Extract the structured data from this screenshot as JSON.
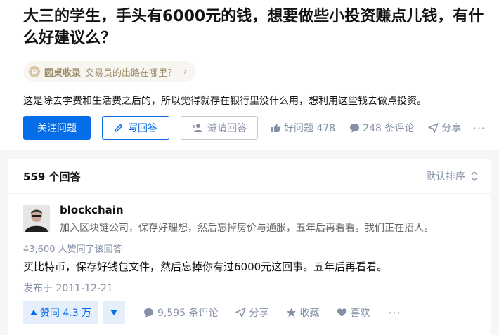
{
  "question": {
    "title": "大三的学生，手头有6000元的钱，想要做些小投资赚点儿钱，有什么好建议么？",
    "roundtable": {
      "name": "圆桌收录",
      "topic": "交易员的出路在哪里？",
      "icon": "roundtable-icon"
    },
    "detail": "这是除去学费和生活费之后的，所以觉得就存在银行里没什么用，想利用这些钱去做点投资。",
    "actions": {
      "follow_label": "关注问题",
      "write_label": "写回答",
      "invite_label": "邀请回答",
      "good_question_label": "好问题 478",
      "comments_label": "248 条评论",
      "share_label": "分享",
      "more_label": "···"
    }
  },
  "answers": {
    "count_label": "559 个回答",
    "sort_label": "默认排序",
    "items": [
      {
        "author_name": "blockchain",
        "author_bio": "加入区块链公司，保存好理想，然后忘掉房价与通胀，五年后再看看。我们正在招人。",
        "votes_summary": "43,600 人赞同了该回答",
        "content": "买比特币，保存好钱包文件，然后忘掉你有过6000元这回事。五年后再看看。",
        "date": "发布于 2011-12-21",
        "vote_up_label": "赞同 4.3 万",
        "comments_label": "9,595 条评论",
        "share_label": "分享",
        "favorite_label": "收藏",
        "like_label": "喜欢",
        "more_label": "···"
      }
    ]
  },
  "colors": {
    "brand_blue": "#056de8",
    "meta_gray": "#8590a6",
    "vote_bg": "#e5effc",
    "roundtable_bg": "#f8f6f0",
    "roundtable_text": "#9c8a6a"
  }
}
